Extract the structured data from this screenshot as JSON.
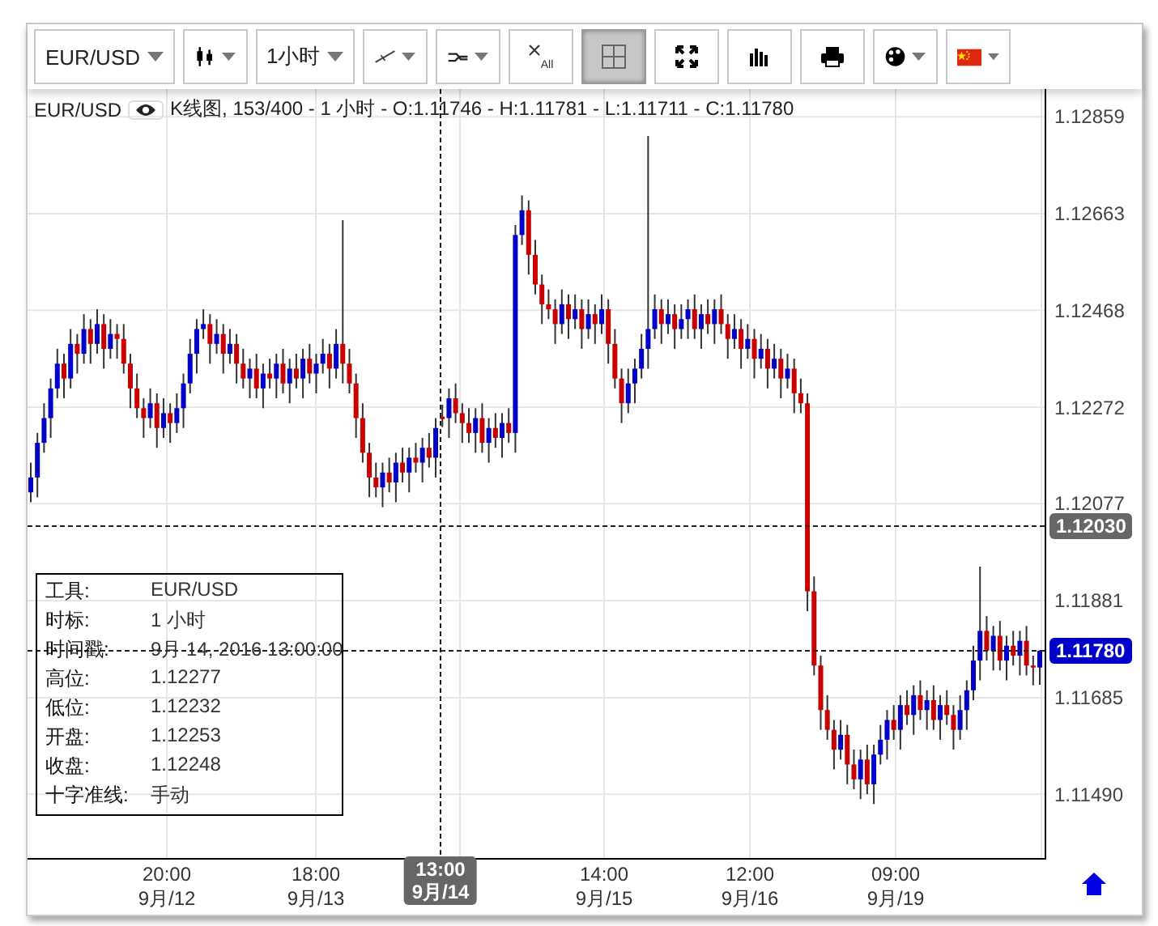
{
  "toolbar": {
    "items": [
      {
        "kind": "text-dropdown",
        "label": "EUR/USD",
        "selected": false
      },
      {
        "kind": "icon-dropdown",
        "selected": false
      },
      {
        "kind": "text-dropdown",
        "label": "1小时",
        "selected": false
      },
      {
        "kind": "icon-dropdown",
        "selected": false
      },
      {
        "kind": "icon-dropdown",
        "selected": false
      },
      {
        "kind": "icon-button",
        "label": "All",
        "selected": false
      },
      {
        "kind": "icon-button",
        "selected": true
      },
      {
        "kind": "icon-button",
        "selected": false
      },
      {
        "kind": "icon-button",
        "selected": false
      },
      {
        "kind": "icon-button",
        "selected": false
      },
      {
        "kind": "icon-dropdown",
        "selected": false
      },
      {
        "kind": "icon-dropdown",
        "selected": false
      }
    ]
  },
  "legend": {
    "symbol": "EUR/USD",
    "visible": true,
    "summary": "K线图, 153/400 - 1 小时 - O:1.11746 - H:1.11781 - L:1.11711 - C:1.11780"
  },
  "info_box": {
    "rows": [
      {
        "label": "工具:",
        "value": "EUR/USD"
      },
      {
        "label": "时标:",
        "value": "1 小时"
      },
      {
        "label": "时间戳:",
        "value": "9月 14, 2016 13:00:00"
      },
      {
        "label": "高位:",
        "value": "1.12277"
      },
      {
        "label": "低位:",
        "value": "1.12232"
      },
      {
        "label": "开盘:",
        "value": "1.12253"
      },
      {
        "label": "收盘:",
        "value": "1.12248"
      },
      {
        "label": "十字准线:",
        "value": "手动"
      }
    ]
  },
  "chart_data": {
    "type": "candlestick",
    "grid": true,
    "ylim": [
      1.11361,
      1.12915
    ],
    "yticks": [
      {
        "value": 1.12859,
        "label": "1.12859"
      },
      {
        "value": 1.12663,
        "label": "1.12663"
      },
      {
        "value": 1.12468,
        "label": "1.12468"
      },
      {
        "value": 1.12272,
        "label": "1.12272"
      },
      {
        "value": 1.12077,
        "label": "1.12077"
      },
      {
        "value": 1.11881,
        "label": "1.11881"
      },
      {
        "value": 1.11685,
        "label": "1.11685"
      },
      {
        "value": 1.1149,
        "label": "1.11490"
      }
    ],
    "categories": [
      null,
      null,
      null,
      null,
      null,
      null,
      null,
      null,
      null,
      null,
      null,
      null,
      null,
      null,
      null,
      null,
      null,
      null,
      null,
      null,
      null,
      null,
      null,
      null,
      null,
      null,
      null,
      null,
      null,
      null,
      null,
      null,
      null,
      null,
      null,
      null,
      null,
      null,
      null,
      null,
      null,
      null,
      null,
      null,
      null,
      null,
      null,
      null,
      null,
      null,
      null,
      null,
      null,
      null,
      null,
      null,
      null,
      null,
      null,
      null,
      null,
      null,
      null,
      null,
      null,
      null,
      null,
      null,
      null,
      null,
      null,
      null,
      null,
      null,
      null,
      null,
      null,
      null,
      null,
      null,
      null,
      null,
      null,
      null,
      null,
      null,
      null,
      null,
      null,
      null,
      null,
      null,
      null,
      null,
      null,
      null,
      null,
      null,
      null,
      null,
      null,
      null,
      null,
      null,
      null,
      null,
      null,
      null,
      null,
      null,
      null,
      null,
      null,
      null,
      null,
      null,
      null,
      null,
      null,
      null,
      null,
      null,
      null,
      null,
      null,
      null,
      null,
      null,
      null,
      null,
      null,
      null,
      null,
      null,
      null,
      null,
      null,
      null,
      null,
      null,
      null,
      null,
      null,
      null,
      null,
      null,
      null,
      null,
      null,
      null,
      null,
      null,
      null
    ],
    "ohlc": [
      [
        1.121,
        1.1216,
        1.1208,
        1.1213
      ],
      [
        1.1213,
        1.1222,
        1.1209,
        1.122
      ],
      [
        1.122,
        1.1228,
        1.1218,
        1.1225
      ],
      [
        1.1225,
        1.1233,
        1.1221,
        1.1231
      ],
      [
        1.1231,
        1.1239,
        1.1229,
        1.1236
      ],
      [
        1.1236,
        1.1238,
        1.1229,
        1.1233
      ],
      [
        1.1233,
        1.1243,
        1.1231,
        1.124
      ],
      [
        1.124,
        1.1242,
        1.1234,
        1.1238
      ],
      [
        1.1238,
        1.1246,
        1.1236,
        1.1243
      ],
      [
        1.1243,
        1.1245,
        1.1236,
        1.124
      ],
      [
        1.124,
        1.1247,
        1.1238,
        1.1244
      ],
      [
        1.1244,
        1.1246,
        1.1235,
        1.1239
      ],
      [
        1.1239,
        1.1245,
        1.1237,
        1.1242
      ],
      [
        1.1242,
        1.1244,
        1.1237,
        1.1241
      ],
      [
        1.1241,
        1.1244,
        1.1234,
        1.1236
      ],
      [
        1.1236,
        1.1238,
        1.1227,
        1.1231
      ],
      [
        1.1231,
        1.1234,
        1.1225,
        1.1227
      ],
      [
        1.1227,
        1.1229,
        1.1221,
        1.1225
      ],
      [
        1.1225,
        1.1231,
        1.1223,
        1.1228
      ],
      [
        1.1228,
        1.123,
        1.1219,
        1.1223
      ],
      [
        1.1223,
        1.1229,
        1.1221,
        1.1226
      ],
      [
        1.1226,
        1.1228,
        1.122,
        1.1224
      ],
      [
        1.1224,
        1.123,
        1.1222,
        1.1227
      ],
      [
        1.1227,
        1.1234,
        1.1223,
        1.1232
      ],
      [
        1.1232,
        1.1241,
        1.123,
        1.1238
      ],
      [
        1.1238,
        1.1245,
        1.1234,
        1.1243
      ],
      [
        1.1243,
        1.1247,
        1.1241,
        1.1244
      ],
      [
        1.1244,
        1.1246,
        1.1236,
        1.124
      ],
      [
        1.124,
        1.1245,
        1.1238,
        1.1242
      ],
      [
        1.1242,
        1.1244,
        1.1234,
        1.1238
      ],
      [
        1.1238,
        1.1243,
        1.1236,
        1.124
      ],
      [
        1.124,
        1.1242,
        1.1232,
        1.1236
      ],
      [
        1.1236,
        1.1239,
        1.1231,
        1.1233
      ],
      [
        1.1233,
        1.1237,
        1.1229,
        1.1235
      ],
      [
        1.1235,
        1.1238,
        1.1229,
        1.1231
      ],
      [
        1.1231,
        1.1236,
        1.1227,
        1.1234
      ],
      [
        1.1234,
        1.1237,
        1.1231,
        1.1233
      ],
      [
        1.1233,
        1.1238,
        1.1229,
        1.1236
      ],
      [
        1.1236,
        1.1239,
        1.123,
        1.1232
      ],
      [
        1.1232,
        1.1237,
        1.1228,
        1.1235
      ],
      [
        1.1235,
        1.1238,
        1.1231,
        1.1233
      ],
      [
        1.1233,
        1.1239,
        1.1229,
        1.1237
      ],
      [
        1.1237,
        1.124,
        1.1232,
        1.1234
      ],
      [
        1.1234,
        1.1238,
        1.123,
        1.1236
      ],
      [
        1.1236,
        1.1241,
        1.1234,
        1.1238
      ],
      [
        1.1238,
        1.124,
        1.1231,
        1.1235
      ],
      [
        1.1235,
        1.1243,
        1.1233,
        1.124
      ],
      [
        1.124,
        1.1265,
        1.1232,
        1.1236
      ],
      [
        1.1236,
        1.1239,
        1.123,
        1.1232
      ],
      [
        1.1232,
        1.1234,
        1.1221,
        1.1225
      ],
      [
        1.1225,
        1.1228,
        1.1216,
        1.1218
      ],
      [
        1.1218,
        1.122,
        1.1209,
        1.1213
      ],
      [
        1.1213,
        1.1216,
        1.1209,
        1.1211
      ],
      [
        1.1211,
        1.1216,
        1.1207,
        1.1214
      ],
      [
        1.1214,
        1.1217,
        1.121,
        1.1212
      ],
      [
        1.1212,
        1.1218,
        1.1208,
        1.1216
      ],
      [
        1.1216,
        1.1219,
        1.1212,
        1.1214
      ],
      [
        1.1214,
        1.1219,
        1.121,
        1.1217
      ],
      [
        1.1217,
        1.122,
        1.1214,
        1.1216
      ],
      [
        1.1216,
        1.1221,
        1.1212,
        1.1219
      ],
      [
        1.1219,
        1.1222,
        1.1215,
        1.1217
      ],
      [
        1.1217,
        1.1225,
        1.1213,
        1.1223
      ],
      [
        1.12253,
        1.12277,
        1.12232,
        1.12248
      ],
      [
        1.1225,
        1.1231,
        1.1221,
        1.1229
      ],
      [
        1.1229,
        1.1232,
        1.1224,
        1.1226
      ],
      [
        1.1226,
        1.1228,
        1.122,
        1.1224
      ],
      [
        1.1224,
        1.1227,
        1.122,
        1.1222
      ],
      [
        1.1222,
        1.1227,
        1.1218,
        1.1225
      ],
      [
        1.1225,
        1.1228,
        1.1218,
        1.122
      ],
      [
        1.122,
        1.1225,
        1.1216,
        1.1223
      ],
      [
        1.1223,
        1.1226,
        1.1219,
        1.1221
      ],
      [
        1.1221,
        1.1226,
        1.1217,
        1.1224
      ],
      [
        1.1224,
        1.1227,
        1.122,
        1.1222
      ],
      [
        1.1222,
        1.1264,
        1.1218,
        1.1262
      ],
      [
        1.1262,
        1.127,
        1.126,
        1.1267
      ],
      [
        1.1267,
        1.1269,
        1.1254,
        1.1258
      ],
      [
        1.1258,
        1.1261,
        1.125,
        1.1252
      ],
      [
        1.1252,
        1.1254,
        1.1244,
        1.1248
      ],
      [
        1.1248,
        1.1251,
        1.1245,
        1.1247
      ],
      [
        1.1247,
        1.1249,
        1.124,
        1.1244
      ],
      [
        1.1244,
        1.1251,
        1.1242,
        1.1248
      ],
      [
        1.1248,
        1.125,
        1.1241,
        1.1245
      ],
      [
        1.1245,
        1.125,
        1.1243,
        1.1247
      ],
      [
        1.1247,
        1.1249,
        1.1239,
        1.1243
      ],
      [
        1.1243,
        1.1249,
        1.1241,
        1.1246
      ],
      [
        1.1246,
        1.1248,
        1.124,
        1.1244
      ],
      [
        1.1244,
        1.125,
        1.1242,
        1.1247
      ],
      [
        1.1247,
        1.1249,
        1.1236,
        1.124
      ],
      [
        1.124,
        1.1243,
        1.1231,
        1.1233
      ],
      [
        1.1233,
        1.1235,
        1.1224,
        1.1228
      ],
      [
        1.1228,
        1.1235,
        1.1226,
        1.1232
      ],
      [
        1.1232,
        1.1237,
        1.1228,
        1.1235
      ],
      [
        1.1235,
        1.1242,
        1.1233,
        1.1239
      ],
      [
        1.1239,
        1.1282,
        1.1235,
        1.1243
      ],
      [
        1.1243,
        1.125,
        1.1241,
        1.1247
      ],
      [
        1.1247,
        1.1249,
        1.124,
        1.1244
      ],
      [
        1.1244,
        1.1249,
        1.1242,
        1.1246
      ],
      [
        1.1246,
        1.1248,
        1.1239,
        1.1243
      ],
      [
        1.1243,
        1.1248,
        1.1241,
        1.1245
      ],
      [
        1.1245,
        1.1249,
        1.1241,
        1.1247
      ],
      [
        1.1247,
        1.125,
        1.1241,
        1.1243
      ],
      [
        1.1243,
        1.1248,
        1.1239,
        1.1246
      ],
      [
        1.1246,
        1.1249,
        1.1242,
        1.1244
      ],
      [
        1.1244,
        1.1249,
        1.124,
        1.1247
      ],
      [
        1.1247,
        1.125,
        1.1242,
        1.1244
      ],
      [
        1.1244,
        1.1246,
        1.1237,
        1.1241
      ],
      [
        1.1241,
        1.1246,
        1.1239,
        1.1243
      ],
      [
        1.1243,
        1.1245,
        1.1235,
        1.1239
      ],
      [
        1.1239,
        1.1244,
        1.1237,
        1.1241
      ],
      [
        1.1241,
        1.1243,
        1.1233,
        1.1237
      ],
      [
        1.1237,
        1.1242,
        1.1235,
        1.1239
      ],
      [
        1.1239,
        1.1241,
        1.1231,
        1.1235
      ],
      [
        1.1235,
        1.124,
        1.1233,
        1.1237
      ],
      [
        1.1237,
        1.1239,
        1.1229,
        1.1233
      ],
      [
        1.1233,
        1.1238,
        1.1231,
        1.1235
      ],
      [
        1.1235,
        1.1237,
        1.1226,
        1.123
      ],
      [
        1.123,
        1.1233,
        1.1226,
        1.1228
      ],
      [
        1.1228,
        1.123,
        1.1186,
        1.119
      ],
      [
        1.119,
        1.1193,
        1.1173,
        1.1175
      ],
      [
        1.1175,
        1.1177,
        1.1162,
        1.1166
      ],
      [
        1.1166,
        1.1169,
        1.116,
        1.1162
      ],
      [
        1.1162,
        1.1164,
        1.1154,
        1.1158
      ],
      [
        1.1158,
        1.1164,
        1.1156,
        1.1161
      ],
      [
        1.1161,
        1.1163,
        1.1151,
        1.1155
      ],
      [
        1.1155,
        1.1158,
        1.115,
        1.1152
      ],
      [
        1.1152,
        1.1158,
        1.1148,
        1.1156
      ],
      [
        1.1156,
        1.1159,
        1.1149,
        1.1151
      ],
      [
        1.1151,
        1.1159,
        1.1147,
        1.1157
      ],
      [
        1.1157,
        1.1163,
        1.1155,
        1.116
      ],
      [
        1.116,
        1.1166,
        1.1156,
        1.1164
      ],
      [
        1.1164,
        1.1167,
        1.116,
        1.1162
      ],
      [
        1.1162,
        1.1169,
        1.1158,
        1.1167
      ],
      [
        1.1167,
        1.117,
        1.1163,
        1.1165
      ],
      [
        1.1165,
        1.1171,
        1.1161,
        1.1169
      ],
      [
        1.1169,
        1.1172,
        1.1164,
        1.1166
      ],
      [
        1.1166,
        1.117,
        1.1162,
        1.1168
      ],
      [
        1.1168,
        1.1171,
        1.1162,
        1.1164
      ],
      [
        1.1164,
        1.1169,
        1.116,
        1.1167
      ],
      [
        1.1167,
        1.117,
        1.1163,
        1.1165
      ],
      [
        1.1165,
        1.1167,
        1.1158,
        1.1162
      ],
      [
        1.1162,
        1.1169,
        1.116,
        1.1166
      ],
      [
        1.1166,
        1.1172,
        1.1162,
        1.117
      ],
      [
        1.117,
        1.1179,
        1.1168,
        1.1176
      ],
      [
        1.1176,
        1.1195,
        1.1172,
        1.1182
      ],
      [
        1.1182,
        1.1185,
        1.1176,
        1.1178
      ],
      [
        1.1178,
        1.1183,
        1.1174,
        1.1181
      ],
      [
        1.1181,
        1.1184,
        1.1174,
        1.1176
      ],
      [
        1.1176,
        1.1181,
        1.1172,
        1.1179
      ],
      [
        1.1179,
        1.1182,
        1.1175,
        1.1177
      ],
      [
        1.1177,
        1.1182,
        1.1173,
        1.118
      ],
      [
        1.118,
        1.1183,
        1.1173,
        1.1175
      ],
      [
        1.1175,
        1.1177,
        1.1171,
        1.11746
      ],
      [
        1.11746,
        1.11781,
        1.11711,
        1.1178
      ]
    ]
  },
  "price_axis": {
    "crosshair_price": "1.12030",
    "last_price": "1.11780"
  },
  "time_axis": {
    "labels": [
      {
        "time": "20:00",
        "date": "9月/12"
      },
      {
        "time": "18:00",
        "date": "9月/13"
      },
      {
        "time": "14:00",
        "date": "9月/15"
      },
      {
        "time": "12:00",
        "date": "9月/16"
      },
      {
        "time": "09:00",
        "date": "9月/19"
      }
    ],
    "crosshair": {
      "time": "13:00",
      "date": "9月/14"
    }
  }
}
